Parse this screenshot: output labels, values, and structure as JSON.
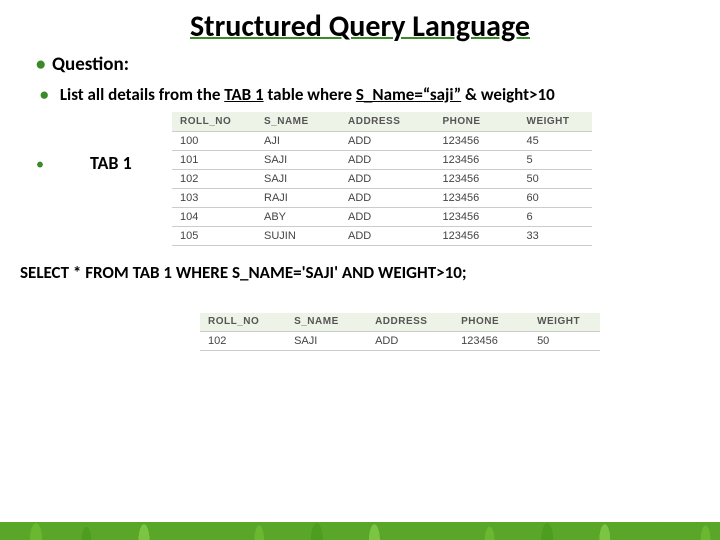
{
  "title": "Structured Query Language",
  "question_label": "Question:",
  "question_text_a": "List all details from the ",
  "question_text_b": "TAB 1",
  "question_text_c": " table where ",
  "question_text_d": "S_Name=“saji”",
  "question_text_e": " & weight>10",
  "tab1_label": "TAB 1",
  "columns": [
    "ROLL_NO",
    "S_NAME",
    "ADDRESS",
    "PHONE",
    "WEIGHT"
  ],
  "rows": [
    [
      "100",
      "AJI",
      "ADD",
      "123456",
      "45"
    ],
    [
      "101",
      "SAJI",
      "ADD",
      "123456",
      "5"
    ],
    [
      "102",
      "SAJI",
      "ADD",
      "123456",
      "50"
    ],
    [
      "103",
      "RAJI",
      "ADD",
      "123456",
      "60"
    ],
    [
      "104",
      "ABY",
      "ADD",
      "123456",
      "6"
    ],
    [
      "105",
      "SUJIN",
      "ADD",
      "123456",
      "33"
    ]
  ],
  "sql": "SELECT * FROM TAB 1 WHERE S_NAME='SAJI' AND WEIGHT>10;",
  "result_rows": [
    [
      "102",
      "SAJI",
      "ADD",
      "123456",
      "50"
    ]
  ]
}
